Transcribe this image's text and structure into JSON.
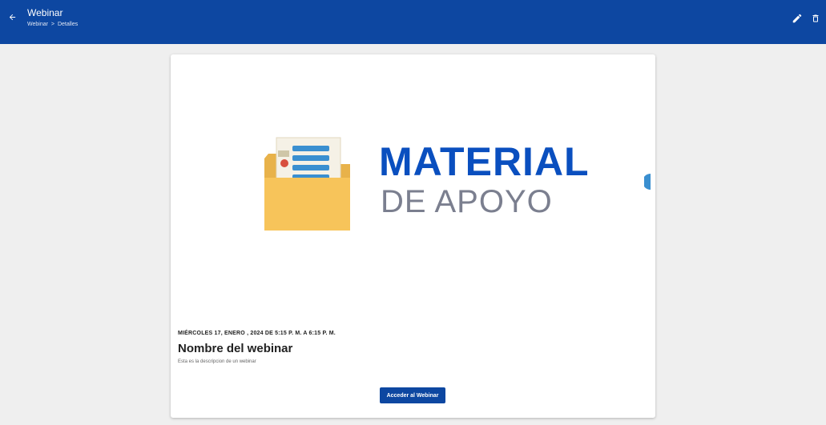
{
  "header": {
    "title": "Webinar",
    "breadcrumb": [
      "Webinar",
      ">",
      "Detalles"
    ],
    "back_icon": "arrow-left-icon",
    "actions": [
      {
        "icon": "pencil-icon"
      },
      {
        "icon": "trash-icon"
      }
    ],
    "bg_color": "#0d47a1"
  },
  "card": {
    "banner": {
      "title": "MATERIAL",
      "subtitle": "DE APOYO",
      "icon": "folder-document-icon",
      "title_color": "#0a4fbf"
    },
    "date_line": "MIÉRCOLES 17, ENERO , 2024  DE  5:15 P. M.  A  6:15 P. M.",
    "name": "Nombre del webinar",
    "description": "Esta es la descripcion de un webinar",
    "button_label": "Acceder al Webinar"
  }
}
